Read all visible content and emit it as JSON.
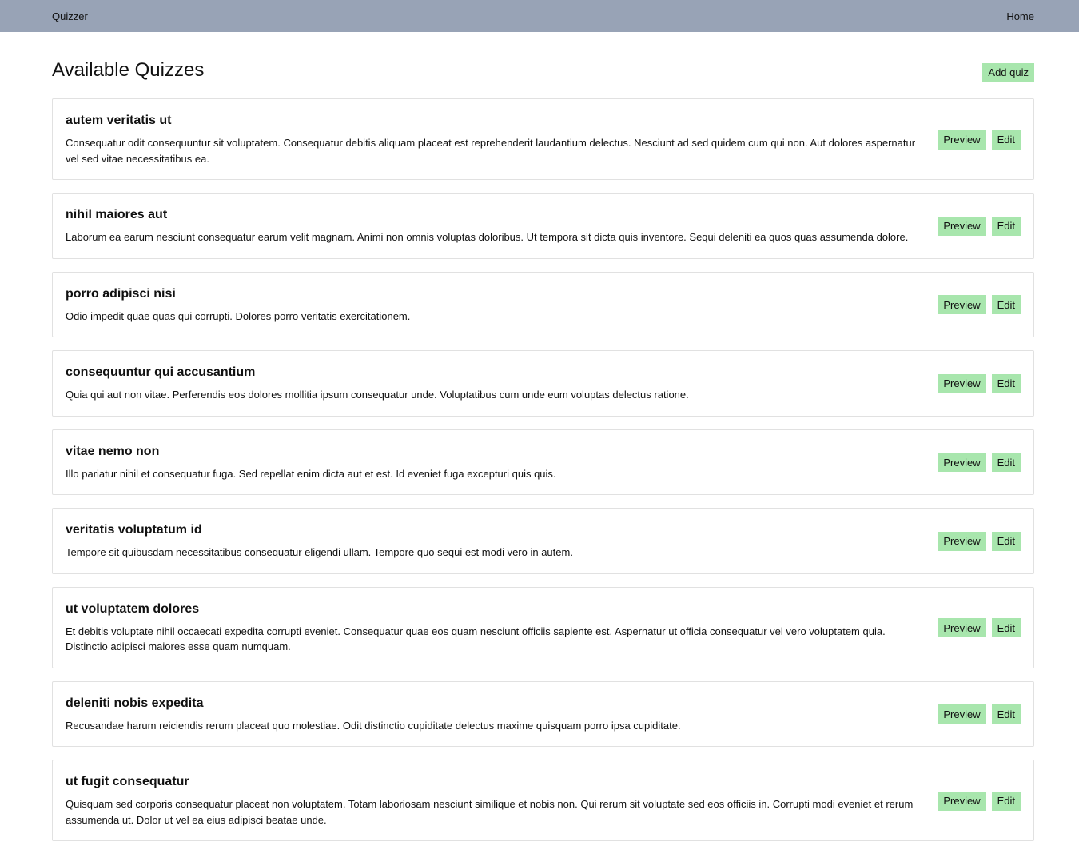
{
  "nav": {
    "brand": "Quizzer",
    "home": "Home"
  },
  "page": {
    "title": "Available Quizzes",
    "add_button": "Add quiz"
  },
  "actions": {
    "preview": "Preview",
    "edit": "Edit"
  },
  "quizzes": [
    {
      "title": "autem veritatis ut",
      "description": "Consequatur odit consequuntur sit voluptatem. Consequatur debitis aliquam placeat est reprehenderit laudantium delectus. Nesciunt ad sed quidem cum qui non. Aut dolores aspernatur vel sed vitae necessitatibus ea."
    },
    {
      "title": "nihil maiores aut",
      "description": "Laborum ea earum nesciunt consequatur earum velit magnam. Animi non omnis voluptas doloribus. Ut tempora sit dicta quis inventore. Sequi deleniti ea quos quas assumenda dolore."
    },
    {
      "title": "porro adipisci nisi",
      "description": "Odio impedit quae quas qui corrupti. Dolores porro veritatis exercitationem."
    },
    {
      "title": "consequuntur qui accusantium",
      "description": "Quia qui aut non vitae. Perferendis eos dolores mollitia ipsum consequatur unde. Voluptatibus cum unde eum voluptas delectus ratione."
    },
    {
      "title": "vitae nemo non",
      "description": "Illo pariatur nihil et consequatur fuga. Sed repellat enim dicta aut et est. Id eveniet fuga excepturi quis quis."
    },
    {
      "title": "veritatis voluptatum id",
      "description": "Tempore sit quibusdam necessitatibus consequatur eligendi ullam. Tempore quo sequi est modi vero in autem."
    },
    {
      "title": "ut voluptatem dolores",
      "description": "Et debitis voluptate nihil occaecati expedita corrupti eveniet. Consequatur quae eos quam nesciunt officiis sapiente est. Aspernatur ut officia consequatur vel vero voluptatem quia. Distinctio adipisci maiores esse quam numquam."
    },
    {
      "title": "deleniti nobis expedita",
      "description": "Recusandae harum reiciendis rerum placeat quo molestiae. Odit distinctio cupiditate delectus maxime quisquam porro ipsa cupiditate."
    },
    {
      "title": "ut fugit consequatur",
      "description": "Quisquam sed corporis consequatur placeat non voluptatem. Totam laboriosam nesciunt similique et nobis non. Qui rerum sit voluptate sed eos officiis in. Corrupti modi eveniet et rerum assumenda ut. Dolor ut vel ea eius adipisci beatae unde."
    }
  ]
}
